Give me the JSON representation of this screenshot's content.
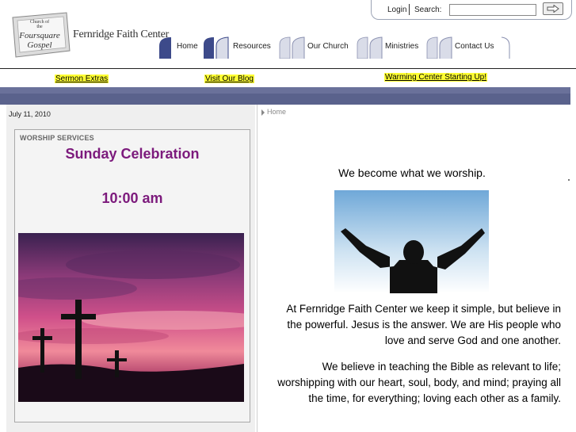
{
  "header": {
    "logo": {
      "badge_lines": [
        "Church of",
        "the",
        "Foursquare",
        "Gospel"
      ],
      "site_name": "Fernridge Faith Center"
    },
    "toolbar": {
      "login_label": "Login",
      "search_label": "Search:",
      "search_value": "",
      "search_button_icon": "arrow-right-icon"
    },
    "nav": [
      {
        "label": "Home"
      },
      {
        "label": "Resources"
      },
      {
        "label": "Our Church"
      },
      {
        "label": "Ministries"
      },
      {
        "label": "Contact Us"
      }
    ]
  },
  "announcements": [
    {
      "label": "Sermon Extras"
    },
    {
      "label": "Visit Our Blog"
    },
    {
      "label": "Warming Center Starting Up!"
    }
  ],
  "sidebar": {
    "date": "July 11, 2010",
    "panel_title": "WORSHIP SERVICES",
    "heading": "Sunday Celebration",
    "time": "10:00 am"
  },
  "main": {
    "breadcrumb": "Home",
    "tagline": "We become what we worship.",
    "paragraphs": [
      "At Fernridge Faith Center we keep it simple, but believe in the powerful. Jesus is the answer. We are His people who love and serve God and one another.",
      "We believe in teaching the Bible as relevant to life; worshipping with our heart, soul, body, and mind; praying all the time, for everything; loving each other as a family."
    ]
  },
  "colors": {
    "accent_purple": "#7c1a7c",
    "banner": "#5a628c",
    "highlight": "#ffff33",
    "nav_tab": "#3d4a8a"
  }
}
